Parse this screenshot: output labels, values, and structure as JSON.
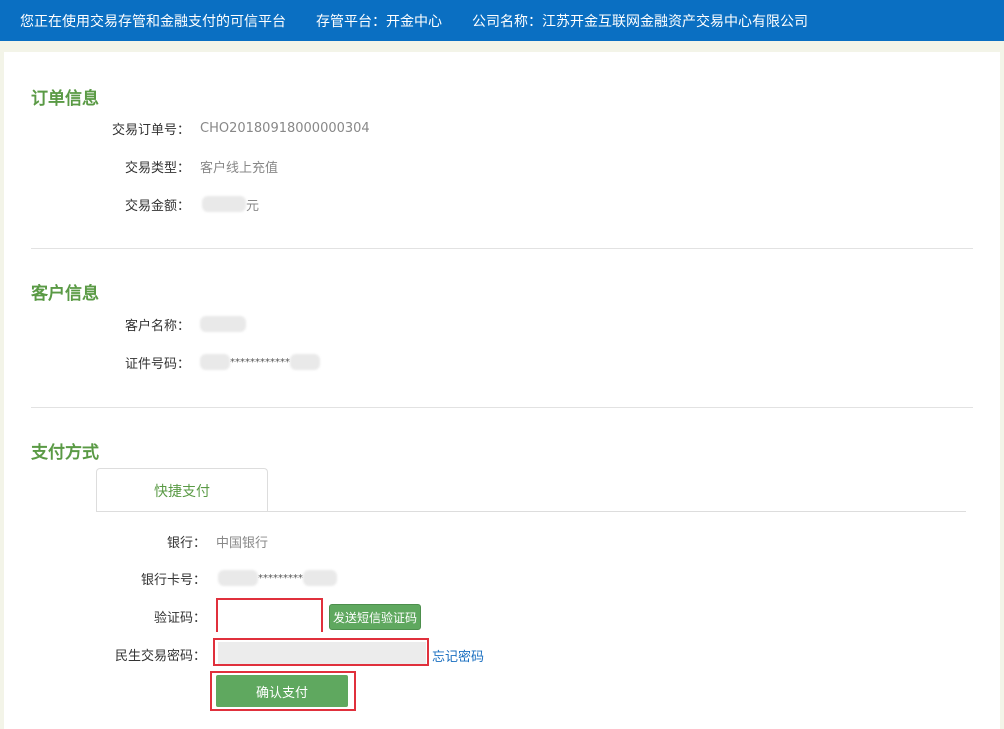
{
  "topbar": {
    "slogan": "您正在使用交易存管和金融支付的可信平台",
    "platform": "存管平台：开金中心",
    "company": "公司名称：江苏开金互联网金融资产交易中心有限公司"
  },
  "order": {
    "title": "订单信息",
    "order_no_label": "交易订单号：",
    "order_no": "CHO20180918000000304",
    "type_label": "交易类型：",
    "type": "客户线上充值",
    "amount_label": "交易金额：",
    "amount_unit": "元"
  },
  "customer": {
    "title": "客户信息",
    "name_label": "客户名称：",
    "id_label": "证件号码：",
    "id_masked": "************"
  },
  "payment": {
    "title": "支付方式",
    "tab": "快捷支付",
    "bank_label": "银行：",
    "bank": "中国银行",
    "card_label": "银行卡号：",
    "card_masked": "*********",
    "code_label": "验证码：",
    "sms_button": "发送短信验证码",
    "password_label": "民生交易密码：",
    "forgot": "忘记密码",
    "confirm": "确认支付"
  },
  "colors": {
    "topbar": "#0a6fc2",
    "accent": "#5a9a45",
    "button": "#5fa85f",
    "highlight": "#e0303c"
  }
}
